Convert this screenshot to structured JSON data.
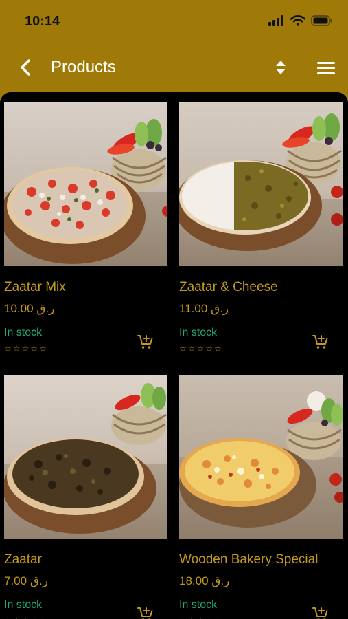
{
  "status": {
    "time": "10:14"
  },
  "header": {
    "title": "Products",
    "back_icon": "chevron-left-icon",
    "sort_icon": "sort-icon",
    "menu_icon": "hamburger-menu-icon"
  },
  "colors": {
    "header_bg": "#a07a08",
    "accent": "#c49a1a",
    "in_stock": "#1faa78",
    "content_bg": "#000000"
  },
  "products": [
    {
      "name": "Zaatar Mix",
      "price": "10.00 ر.ق",
      "stock": "In stock",
      "rating": "☆☆☆☆☆",
      "topping": "mix"
    },
    {
      "name": "Zaatar & Cheese",
      "price": "11.00 ر.ق",
      "stock": "In stock",
      "rating": "☆☆☆☆☆",
      "topping": "half"
    },
    {
      "name": "Zaatar",
      "price": "7.00 ر.ق",
      "stock": "In stock",
      "rating": "☆☆☆☆☆",
      "topping": "zaatar"
    },
    {
      "name": "Wooden Bakery Special",
      "price": "18.00 ر.ق",
      "stock": "In stock",
      "rating": "☆☆☆☆☆",
      "topping": "cheese"
    }
  ]
}
